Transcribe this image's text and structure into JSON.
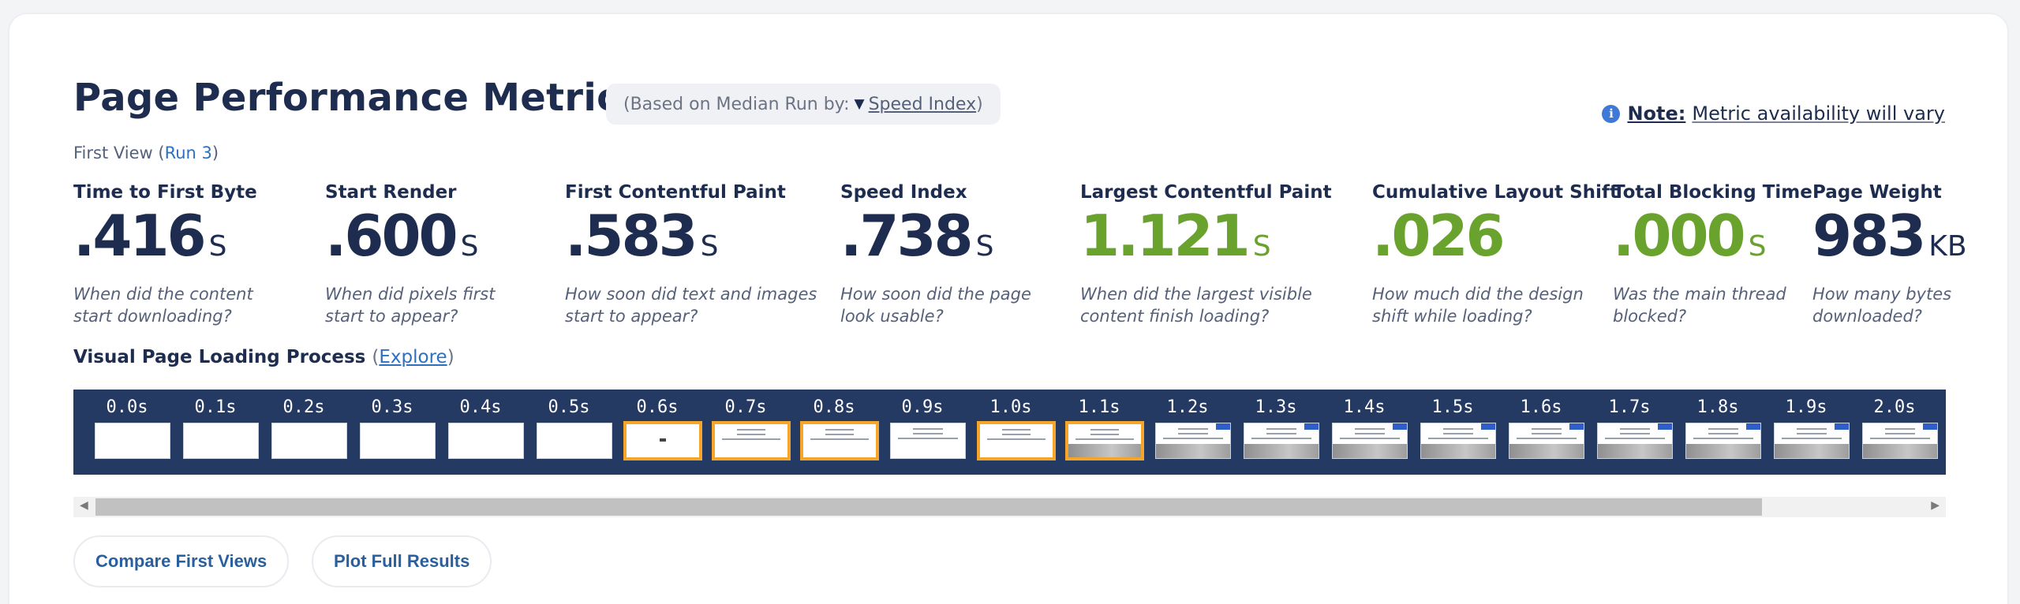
{
  "title": "Page Performance Metrics",
  "median_badge": {
    "prefix": "(Based on Median Run by:",
    "arrow": "▼",
    "selected": "Speed Index",
    "suffix": ")"
  },
  "note": {
    "icon": "info-icon",
    "label": "Note:",
    "text": "Metric availability will vary"
  },
  "first_view": {
    "prefix": "First View (",
    "run": "Run 3",
    "suffix": ")"
  },
  "colors": {
    "dark": "#1e2d4f",
    "green": "#6aa22e",
    "link": "#2f6fbf",
    "filmstrip_bg": "#253a62",
    "changed_frame": "#f3a629"
  },
  "metrics": [
    {
      "label": "Time to First Byte",
      "value": ".416",
      "unit": "S",
      "desc": "When did the content start downloading?",
      "status": "neutral"
    },
    {
      "label": "Start Render",
      "value": ".600",
      "unit": "S",
      "desc": "When did pixels first start to appear?",
      "status": "neutral"
    },
    {
      "label": "First Contentful Paint",
      "value": ".583",
      "unit": "S",
      "desc": "How soon did text and images start to appear?",
      "status": "neutral"
    },
    {
      "label": "Speed Index",
      "value": ".738",
      "unit": "S",
      "desc": "How soon did the page look usable?",
      "status": "neutral"
    },
    {
      "label": "Largest Contentful Paint",
      "value": "1.121",
      "unit": "S",
      "desc": "When did the largest visible content finish loading?",
      "status": "good"
    },
    {
      "label": "Cumulative Layout Shift",
      "value": ".026",
      "unit": "",
      "desc": "How much did the design shift while loading?",
      "status": "good"
    },
    {
      "label": "Total Blocking Time",
      "value": ".000",
      "unit": "S",
      "desc": "Was the main thread blocked?",
      "status": "good"
    },
    {
      "label": "Page Weight",
      "value": "983",
      "unit": "KB",
      "desc": "How many bytes downloaded?",
      "status": "neutral"
    }
  ],
  "visual": {
    "title": "Visual Page Loading Process",
    "paren_open": "(",
    "explore": "Explore",
    "paren_close": ")"
  },
  "filmstrip": [
    {
      "time": "0.0s",
      "state": "blank",
      "changed": false
    },
    {
      "time": "0.1s",
      "state": "blank",
      "changed": false
    },
    {
      "time": "0.2s",
      "state": "blank",
      "changed": false
    },
    {
      "time": "0.3s",
      "state": "blank",
      "changed": false
    },
    {
      "time": "0.4s",
      "state": "blank",
      "changed": false
    },
    {
      "time": "0.5s",
      "state": "blank",
      "changed": false
    },
    {
      "time": "0.6s",
      "state": "dot",
      "changed": true
    },
    {
      "time": "0.7s",
      "state": "text",
      "changed": true
    },
    {
      "time": "0.8s",
      "state": "text",
      "changed": true
    },
    {
      "time": "0.9s",
      "state": "text",
      "changed": false
    },
    {
      "time": "1.0s",
      "state": "text",
      "changed": true
    },
    {
      "time": "1.1s",
      "state": "full",
      "changed": true
    },
    {
      "time": "1.2s",
      "state": "full",
      "changed": false
    },
    {
      "time": "1.3s",
      "state": "full",
      "changed": false
    },
    {
      "time": "1.4s",
      "state": "full",
      "changed": false
    },
    {
      "time": "1.5s",
      "state": "full",
      "changed": false
    },
    {
      "time": "1.6s",
      "state": "full",
      "changed": false
    },
    {
      "time": "1.7s",
      "state": "full",
      "changed": false
    },
    {
      "time": "1.8s",
      "state": "full",
      "changed": false
    },
    {
      "time": "1.9s",
      "state": "full",
      "changed": false
    },
    {
      "time": "2.0s",
      "state": "full",
      "changed": false
    }
  ],
  "scroll": {
    "position": 0,
    "visible_fraction": 0.9
  },
  "buttons": {
    "compare": "Compare First Views",
    "plot": "Plot Full Results"
  }
}
